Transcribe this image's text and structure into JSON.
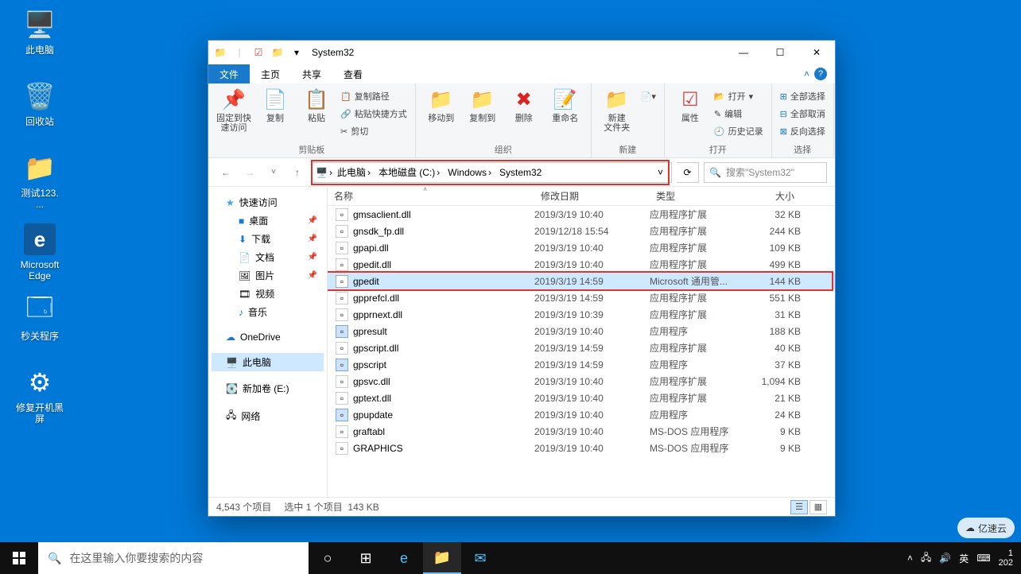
{
  "desktop": [
    {
      "id": "thispc",
      "label": "此电脑",
      "icon": "🖥️"
    },
    {
      "id": "recycle",
      "label": "回收站",
      "icon": "🗑️"
    },
    {
      "id": "test",
      "label": "测试123.\n...",
      "icon": "📁"
    },
    {
      "id": "edge",
      "label": "Microsoft\nEdge",
      "icon": "e"
    },
    {
      "id": "secproc",
      "label": "秒关程序",
      "icon": "🗔"
    },
    {
      "id": "fixboot",
      "label": "修复开机黑\n屏",
      "icon": "⚙"
    }
  ],
  "window": {
    "title": "System32",
    "tabs": {
      "file": "文件",
      "home": "主页",
      "share": "共享",
      "view": "查看"
    },
    "ribbon": {
      "pin": "固定到快\n速访问",
      "copy": "复制",
      "paste": "粘贴",
      "copypath": "复制路径",
      "pasteshortcut": "粘贴快捷方式",
      "cut": "剪切",
      "clip": "剪贴板",
      "moveto": "移动到",
      "copyto": "复制到",
      "delete": "删除",
      "rename": "重命名",
      "org": "组织",
      "newfolder": "新建\n文件夹",
      "new": "新建",
      "props": "属性",
      "open": "打开",
      "edit": "编辑",
      "history": "历史记录",
      "openg": "打开",
      "selectall": "全部选择",
      "selectnone": "全部取消",
      "invert": "反向选择",
      "selectg": "选择"
    },
    "breadcrumb": [
      "此电脑",
      "本地磁盘 (C:)",
      "Windows",
      "System32"
    ],
    "search_placeholder": "搜索\"System32\"",
    "nav": {
      "quick": "快速访问",
      "desktop": "桌面",
      "downloads": "下载",
      "documents": "文档",
      "pictures": "图片",
      "videos": "视频",
      "music": "音乐",
      "onedrive": "OneDrive",
      "thispc": "此电脑",
      "newvol": "新加卷 (E:)",
      "network": "网络"
    },
    "cols": {
      "name": "名称",
      "date": "修改日期",
      "type": "类型",
      "size": "大小"
    },
    "files": [
      {
        "n": "gmsaclient.dll",
        "d": "2019/3/19 10:40",
        "t": "应用程序扩展",
        "s": "32 KB",
        "k": "dll"
      },
      {
        "n": "gnsdk_fp.dll",
        "d": "2019/12/18 15:54",
        "t": "应用程序扩展",
        "s": "244 KB",
        "k": "dll"
      },
      {
        "n": "gpapi.dll",
        "d": "2019/3/19 10:40",
        "t": "应用程序扩展",
        "s": "109 KB",
        "k": "dll"
      },
      {
        "n": "gpedit.dll",
        "d": "2019/3/19 10:40",
        "t": "应用程序扩展",
        "s": "499 KB",
        "k": "dll"
      },
      {
        "n": "gpedit",
        "d": "2019/3/19 14:59",
        "t": "Microsoft 通用管...",
        "s": "144 KB",
        "k": "msc",
        "sel": true
      },
      {
        "n": "gpprefcl.dll",
        "d": "2019/3/19 14:59",
        "t": "应用程序扩展",
        "s": "551 KB",
        "k": "dll"
      },
      {
        "n": "gpprnext.dll",
        "d": "2019/3/19 10:39",
        "t": "应用程序扩展",
        "s": "31 KB",
        "k": "dll"
      },
      {
        "n": "gpresult",
        "d": "2019/3/19 10:40",
        "t": "应用程序",
        "s": "188 KB",
        "k": "exe"
      },
      {
        "n": "gpscript.dll",
        "d": "2019/3/19 14:59",
        "t": "应用程序扩展",
        "s": "40 KB",
        "k": "dll"
      },
      {
        "n": "gpscript",
        "d": "2019/3/19 14:59",
        "t": "应用程序",
        "s": "37 KB",
        "k": "exe"
      },
      {
        "n": "gpsvc.dll",
        "d": "2019/3/19 10:40",
        "t": "应用程序扩展",
        "s": "1,094 KB",
        "k": "dll"
      },
      {
        "n": "gptext.dll",
        "d": "2019/3/19 10:40",
        "t": "应用程序扩展",
        "s": "21 KB",
        "k": "dll"
      },
      {
        "n": "gpupdate",
        "d": "2019/3/19 10:40",
        "t": "应用程序",
        "s": "24 KB",
        "k": "exe"
      },
      {
        "n": "graftabl",
        "d": "2019/3/19 10:40",
        "t": "MS-DOS 应用程序",
        "s": "9 KB",
        "k": "com"
      },
      {
        "n": "GRAPHICS",
        "d": "2019/3/19 10:40",
        "t": "MS-DOS 应用程序",
        "s": "9 KB",
        "k": "com"
      }
    ],
    "status": {
      "count": "4,543 个项目",
      "sel": "选中 1 个项目",
      "size": "143 KB"
    }
  },
  "taskbar": {
    "search": "在这里输入你要搜索的内容",
    "tray": {
      "ime": "英",
      "time": "1",
      "date": "202"
    }
  },
  "watermark": "亿速云"
}
